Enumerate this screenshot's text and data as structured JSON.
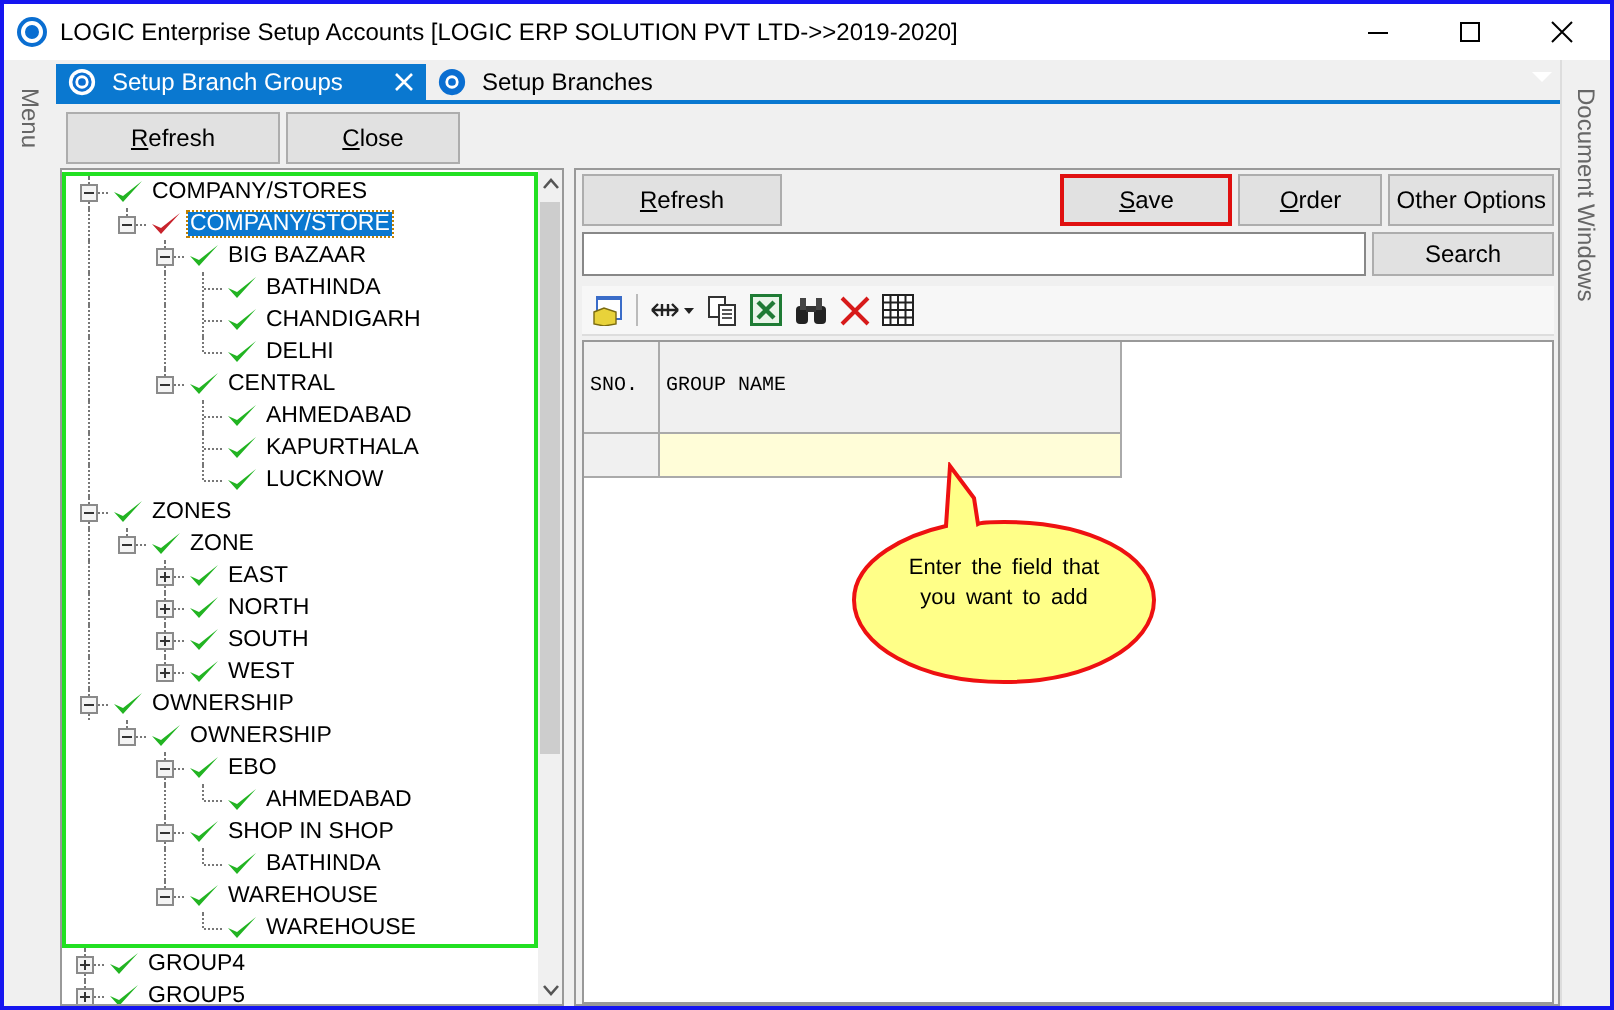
{
  "window": {
    "title": "LOGIC Enterprise Setup Accounts  [LOGIC ERP SOLUTION PVT LTD->>2019-2020]"
  },
  "left_strip": {
    "label": "Menu"
  },
  "right_strip": {
    "label": "Document Windows"
  },
  "tabs": [
    {
      "label": "Setup Branch Groups",
      "selected": true
    },
    {
      "label": "Setup Branches",
      "selected": false
    }
  ],
  "top_buttons": [
    {
      "label": "Refresh",
      "mnemonic": true
    },
    {
      "label": "Close",
      "mnemonic": true
    }
  ],
  "tree": {
    "framed_nodes": [
      {
        "label": "COMPANY/STORES",
        "expanded": true,
        "selected": false,
        "children": [
          {
            "label": "COMPANY/STORE",
            "expanded": true,
            "selected": true,
            "children": [
              {
                "label": "BIG BAZAAR",
                "expanded": true,
                "selected": false,
                "children": [
                  {
                    "label": "BATHINDA",
                    "selected": false
                  },
                  {
                    "label": "CHANDIGARH",
                    "selected": false
                  },
                  {
                    "label": "DELHI",
                    "selected": false
                  }
                ]
              },
              {
                "label": "CENTRAL",
                "expanded": true,
                "selected": false,
                "children": [
                  {
                    "label": "AHMEDABAD",
                    "selected": false
                  },
                  {
                    "label": "KAPURTHALA",
                    "selected": false
                  },
                  {
                    "label": "LUCKNOW",
                    "selected": false
                  }
                ]
              }
            ]
          }
        ]
      },
      {
        "label": "ZONES",
        "expanded": true,
        "selected": false,
        "children": [
          {
            "label": "ZONE",
            "expanded": true,
            "selected": false,
            "children": [
              {
                "label": "EAST",
                "expanded": false,
                "selected": false
              },
              {
                "label": "NORTH",
                "expanded": false,
                "selected": false
              },
              {
                "label": "SOUTH",
                "expanded": false,
                "selected": false
              },
              {
                "label": "WEST",
                "expanded": false,
                "selected": false
              }
            ]
          }
        ]
      },
      {
        "label": "OWNERSHIP",
        "expanded": true,
        "selected": false,
        "children": [
          {
            "label": "OWNERSHIP",
            "expanded": true,
            "selected": false,
            "children": [
              {
                "label": "EBO",
                "expanded": true,
                "selected": false,
                "children": [
                  {
                    "label": "AHMEDABAD",
                    "selected": false
                  }
                ]
              },
              {
                "label": "SHOP IN SHOP",
                "expanded": true,
                "selected": false,
                "children": [
                  {
                    "label": "BATHINDA",
                    "selected": false
                  }
                ]
              },
              {
                "label": "WAREHOUSE",
                "expanded": true,
                "selected": false,
                "children": [
                  {
                    "label": "WAREHOUSE",
                    "selected": false
                  }
                ]
              }
            ]
          }
        ]
      }
    ],
    "nodes": [
      {
        "label": "GROUP4",
        "expanded": false,
        "selected": false
      },
      {
        "label": "GROUP5",
        "expanded": false,
        "selected": false
      }
    ]
  },
  "panel_buttons": [
    {
      "label": "Refresh",
      "mnemonic": true,
      "highlighted": false,
      "kind": "left"
    },
    {
      "label": "Save",
      "mnemonic": true,
      "highlighted": true,
      "kind": "right"
    },
    {
      "label": "Order",
      "mnemonic": true,
      "highlighted": false,
      "kind": "right"
    },
    {
      "label": "Other Options",
      "mnemonic": false,
      "highlighted": false,
      "kind": "right"
    }
  ],
  "search": {
    "button": "Search"
  },
  "grid": {
    "columns": [
      "SNO.",
      "GROUP NAME"
    ]
  },
  "callout": {
    "text": "Enter the field that you want to add"
  }
}
